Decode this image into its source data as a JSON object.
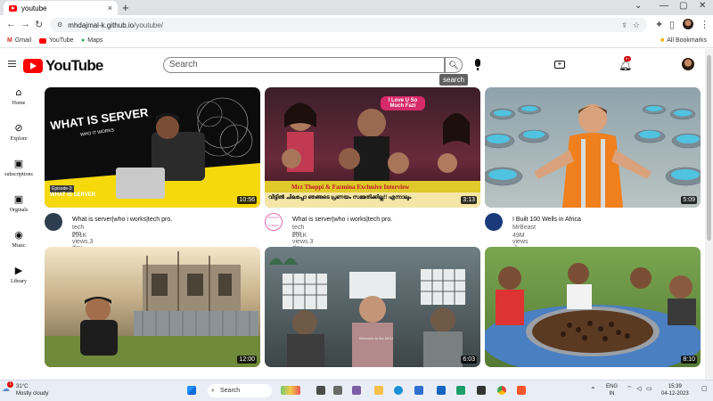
{
  "browser": {
    "tab_title": "youtube",
    "tab_close": "×",
    "new_tab": "+",
    "window_controls": [
      "⌄",
      "—",
      "▢",
      "✕"
    ],
    "url_host": "mhdajmal-k.github.io",
    "url_path": "/youtube/",
    "bookmarks": [
      "Gmail",
      "YouTube",
      "Maps"
    ],
    "all_bookmarks": "All Bookmarks"
  },
  "header": {
    "logo_text": "YouTube",
    "search_placeholder": "Search",
    "search_tooltip": "search",
    "notification_count": "9+"
  },
  "sidebar": {
    "items": [
      {
        "label": "Home",
        "icon": "home-icon"
      },
      {
        "label": "Explore",
        "icon": "compass-icon"
      },
      {
        "label": "subscriptions",
        "icon": "subscriptions-icon"
      },
      {
        "label": "Orginals",
        "icon": "originals-icon"
      },
      {
        "label": "Music",
        "icon": "music-icon"
      },
      {
        "label": "Library",
        "icon": "library-icon"
      }
    ]
  },
  "videos": [
    {
      "title": "What is server|who i works|tech pro.",
      "channel": "tech pro",
      "meta": "231K views.3 day ago",
      "duration": "10:56",
      "thumb_text": "WHAT IS SERVER",
      "thumb_sub": "WHO IT WORKS",
      "thumb_tag": "Episode-3",
      "thumb_bottom": "WHAT IS SERVER"
    },
    {
      "title": "What is server|who i works|tech pro.",
      "channel": "tech pro",
      "meta": "231K views.3 day ago",
      "duration": "3:13",
      "thumb_text": "I Love U So Much Fazi",
      "thumb_banner": "Mrz Thoppi & Fazmina  Exclusive Interview",
      "thumb_sub": "വീട്ടിൽ ചിലപ്പോ ഞങ്ങടെ പ്രണയം സമ്മതിക്കില്ല!! എന്നാലും",
      "channel_badge": "DOMAIN CAMERA"
    },
    {
      "title": "I Built 100 Wells in Africa",
      "channel": "MrBeast",
      "meta": "49M views .1 day ago",
      "duration": "5:09"
    },
    {
      "title": "",
      "channel": "",
      "meta": "",
      "duration": "12:00"
    },
    {
      "title": "",
      "channel": "",
      "meta": "",
      "duration": "6:03",
      "thumb_text": "Welcome to the MCU"
    },
    {
      "title": "",
      "channel": "",
      "meta": "",
      "duration": "8:10"
    }
  ],
  "taskbar": {
    "weather_temp": "31°C",
    "weather_desc": "Mostly cloudy",
    "weather_badge": "1",
    "search_label": "Search",
    "lang_top": "ENG",
    "lang_bottom": "IN",
    "time": "15:39",
    "date": "04-12-2023"
  },
  "colors": {
    "accent": "#ff0000",
    "chrome_frame": "#dfe1e5",
    "taskbar": "#e9eef6"
  }
}
